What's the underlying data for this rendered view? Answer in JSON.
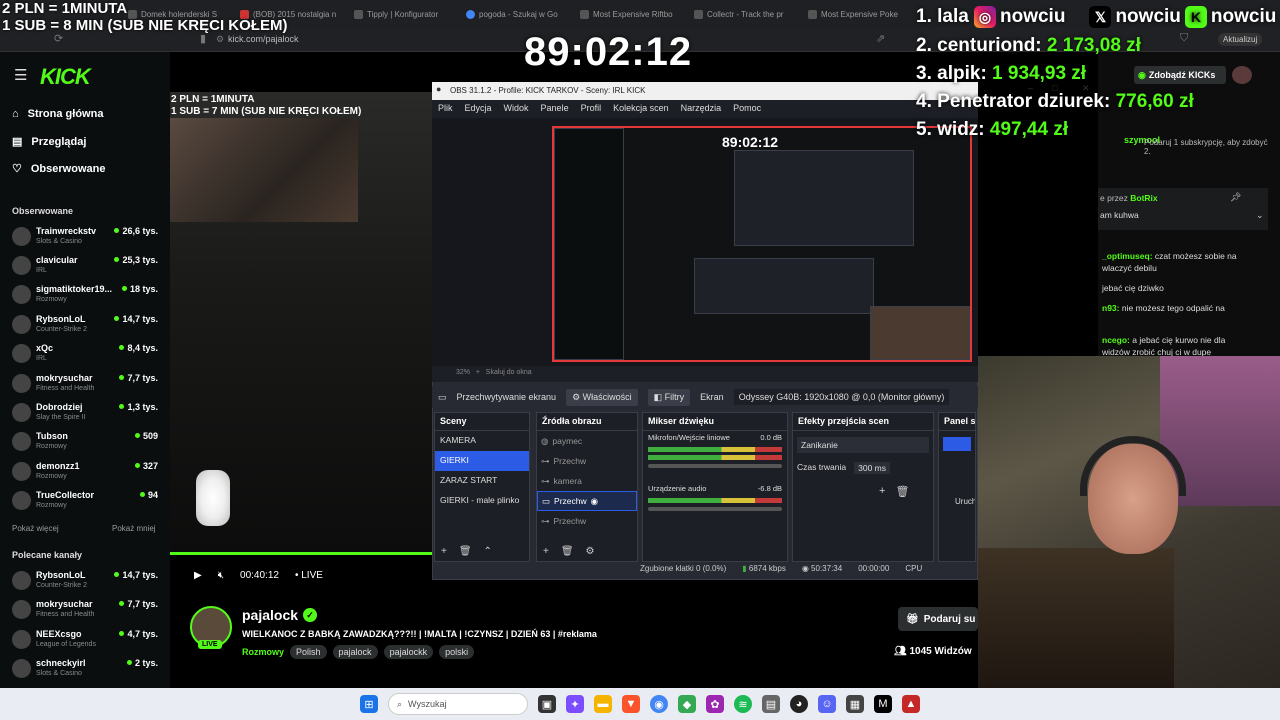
{
  "overlay": {
    "sub_line1": "2 PLN = 1MINUTA",
    "sub_line2": "1 SUB = 8 MIN (SUB NIE KRĘCI KOŁEM)",
    "timer": "89:02:12",
    "leaderboard": [
      {
        "rank": "1.",
        "name": "lala",
        "amount": ""
      },
      {
        "rank": "2.",
        "name": "centuriond:",
        "amount": "2 173,08 zł"
      },
      {
        "rank": "3.",
        "name": "alpik:",
        "amount": "1 934,93 zł"
      },
      {
        "rank": "4.",
        "name": "Penetrator dziurek:",
        "amount": "776,60 zł"
      },
      {
        "rank": "5.",
        "name": "widz:",
        "amount": "497,44 zł"
      }
    ],
    "socials": {
      "handle1": "nowciu",
      "handle2": "nowciu",
      "handle3": "nowciu"
    }
  },
  "browser": {
    "tabs": [
      "Domek holenderski S",
      "(BOB) 2015 nostalgia n",
      "Tipply | Konfigurator",
      "pogoda - Szukaj w Go",
      "Most Expensive Riftbo",
      "Collectr - Track the pr",
      "Most Expensive Poke"
    ],
    "url": "kick.com/pajalock",
    "update_label": "Aktualizuj"
  },
  "kick": {
    "logo": "KICK",
    "nav": [
      {
        "label": "Strona główna",
        "icon": "home-icon"
      },
      {
        "label": "Przeglądaj",
        "icon": "browse-icon"
      },
      {
        "label": "Obserwowane",
        "icon": "heart-icon"
      }
    ],
    "followed_title": "Obserwowane",
    "followed": [
      {
        "name": "Trainwreckstv",
        "category": "Slots & Casino",
        "viewers": "26,6 tys."
      },
      {
        "name": "clavicular",
        "category": "IRL",
        "viewers": "25,3 tys."
      },
      {
        "name": "sigmatiktoker19...",
        "category": "Rozmowy",
        "viewers": "18 tys."
      },
      {
        "name": "RybsonLoL",
        "category": "Counter-Strike 2",
        "viewers": "14,7 tys."
      },
      {
        "name": "xQc",
        "category": "IRL",
        "viewers": "8,4 tys."
      },
      {
        "name": "mokrysuchar",
        "category": "Fitness and Health",
        "viewers": "7,7 tys."
      },
      {
        "name": "Dobrodziej",
        "category": "Slay the Spire II",
        "viewers": "1,3 tys."
      },
      {
        "name": "Tubson",
        "category": "Rozmowy",
        "viewers": "509"
      },
      {
        "name": "demonzz1",
        "category": "Rozmowy",
        "viewers": "327"
      },
      {
        "name": "TrueCollector",
        "category": "Rozmowy",
        "viewers": "94"
      }
    ],
    "show_more": "Pokaż więcej",
    "show_less": "Pokaż mniej",
    "recommended_title": "Polecane kanały",
    "recommended": [
      {
        "name": "RybsonLoL",
        "category": "Counter-Strike 2",
        "viewers": "14,7 tys."
      },
      {
        "name": "mokrysuchar",
        "category": "Fitness and Health",
        "viewers": "7,7 tys."
      },
      {
        "name": "NEEXcsgo",
        "category": "League of Legends",
        "viewers": "4,7 tys."
      },
      {
        "name": "schneckyirl",
        "category": "Slots & Casino",
        "viewers": "2 tys."
      }
    ],
    "video": {
      "sub_line1": "2 PLN = 1MINUTA",
      "sub_line2": "1 SUB = 7 MIN (SUB NIE KRĘCI KOŁEM)",
      "time": "00:40:12",
      "live": "LIVE"
    },
    "channel": {
      "name": "pajalock",
      "title": "WIELKANOC Z BABKĄ ZAWADZKĄ???!! | !MALTA | !CZYNSZ | DZIEŃ 63 | #reklama",
      "category": "Rozmowy",
      "tags": [
        "Polish",
        "pajalock",
        "pajalockk",
        "polski"
      ],
      "live_badge": "LIVE",
      "gift_button": "Podaruj su",
      "viewers": "1045 Widzów"
    },
    "chat": {
      "kicks_button": "Zdobądź KICKs",
      "user1": "szymool",
      "promo": "Podaruj 1 subskrypcję, aby zdobyć 2.",
      "pinned_by": "e przez",
      "pinned_user": "BotRix",
      "pinned_text": "am kuhwa",
      "messages": [
        {
          "user": "_optimuseq:",
          "text": "czat możesz sobie na wlaczyć debilu",
          "color": "#53fc18"
        },
        {
          "user": "",
          "text": "jebać cię dziwko",
          "color": "#53fc18"
        },
        {
          "user": "n93:",
          "text": "nie możesz tego odpalić na",
          "color": "#53fc18"
        },
        {
          "user": "ncego:",
          "text": "a jebać cię kurwo nie dla widzów zrobić chuj ci w dupe",
          "color": "#53fc18"
        }
      ]
    }
  },
  "obs": {
    "title": "OBS 31.1.2 - Profile: KICK TARKOV - Sceny: IRL KICK",
    "menu": [
      "Plik",
      "Edycja",
      "Widok",
      "Panele",
      "Profil",
      "Kolekcja scen",
      "Narzędzia",
      "Pomoc"
    ],
    "inner_timer": "89:02:12",
    "preview_zoom": "32%",
    "preview_hint": "Skaluj do okna",
    "capture_label": "Przechwytywanie ekranu",
    "properties": "Właściwości",
    "filters": "Filtry",
    "screen_label": "Ekran",
    "monitor": "Odyssey G40B: 1920x1080 @ 0,0 (Monitor główny)",
    "scenes_title": "Sceny",
    "scenes": [
      "KAMERA",
      "GIERKI",
      "ZARAZ START",
      "GIERKI - male plinko"
    ],
    "sources_title": "Źródła obrazu",
    "sources": [
      "paymec",
      "Przechw",
      "kamera",
      "Przechw",
      "Przechw"
    ],
    "mixer_title": "Mikser dźwięku",
    "mixer": [
      {
        "name": "Mikrofon/Wejście liniowe",
        "db": "0.0 dB"
      },
      {
        "name": "Urządzenie audio",
        "db": "-6.8 dB"
      }
    ],
    "transitions_title": "Efekty przejścia scen",
    "transition": "Zanikanie",
    "duration_label": "Czas trwania",
    "duration": "300 ms",
    "controls_title": "Panel st",
    "start_label": "Urucho",
    "status": {
      "dropped": "Zgubione klatki 0 (0.0%)",
      "bitrate": "6874 kbps",
      "live_time": "50:37:34",
      "rec_time": "00:00:00",
      "cpu": "CPU"
    }
  },
  "taskbar": {
    "search_placeholder": "Wyszukaj"
  },
  "colors": {
    "kick_green": "#53fc18",
    "obs_select": "#2c5ce6",
    "obs_bg": "#272a33"
  }
}
